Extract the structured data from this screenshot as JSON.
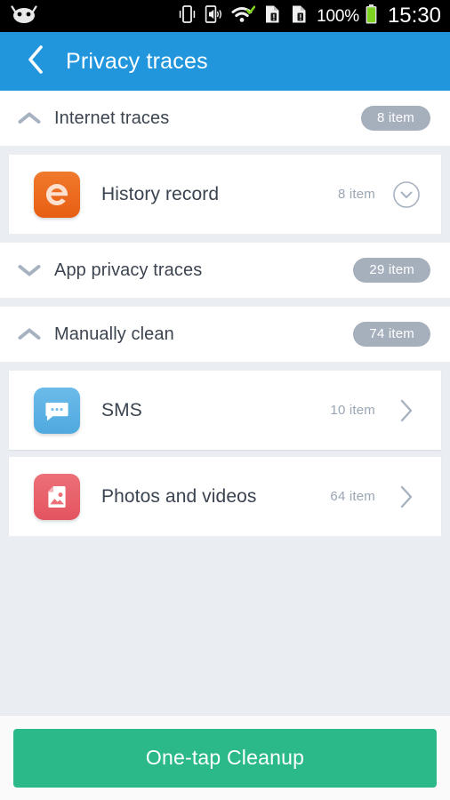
{
  "statusbar": {
    "time": "15:30",
    "battery_percent": "100%",
    "icons": [
      {
        "name": "android-robot-icon"
      },
      {
        "name": "vibrate-icon"
      },
      {
        "name": "ringer-sound-icon"
      },
      {
        "name": "wifi-icon"
      },
      {
        "name": "sim-card-1-alert-icon"
      },
      {
        "name": "sim-card-2-alert-icon"
      },
      {
        "name": "battery-icon"
      }
    ]
  },
  "appbar": {
    "back_icon": "chevron-left-icon",
    "title": "Privacy traces",
    "background_color": "#2196dd"
  },
  "sections": [
    {
      "id": "internet-traces",
      "title": "Internet traces",
      "badge": "8 item",
      "expanded": true,
      "chevron": "chevron-up-icon",
      "rows": [
        {
          "id": "history-record",
          "label": "History record",
          "count": "8 item",
          "icon": "browser-e-icon",
          "icon_color": "#ed6a1f",
          "action": "circle-chevron-down-icon"
        }
      ]
    },
    {
      "id": "app-privacy-traces",
      "title": "App privacy traces",
      "badge": "29 item",
      "expanded": false,
      "chevron": "chevron-down-icon",
      "rows": []
    },
    {
      "id": "manually-clean",
      "title": "Manually clean",
      "badge": "74 item",
      "expanded": true,
      "chevron": "chevron-up-icon",
      "rows": [
        {
          "id": "sms",
          "label": "SMS",
          "count": "10 item",
          "icon": "sms-bubble-icon",
          "icon_color": "#5cb3e6",
          "action": "chevron-right-icon"
        },
        {
          "id": "photos-and-videos",
          "label": "Photos and videos",
          "count": "64 item",
          "icon": "photo-image-icon",
          "icon_color": "#e8606a",
          "action": "chevron-right-icon"
        }
      ]
    }
  ],
  "bottom": {
    "cleanup_label": "One-tap Cleanup",
    "cleanup_color": "#2bb98a"
  },
  "colors": {
    "page_background": "#eaeef2",
    "card_background": "#ffffff",
    "badge": "#a6b0bd",
    "muted_text": "#9aa6b4",
    "title_text": "#3a4350"
  }
}
